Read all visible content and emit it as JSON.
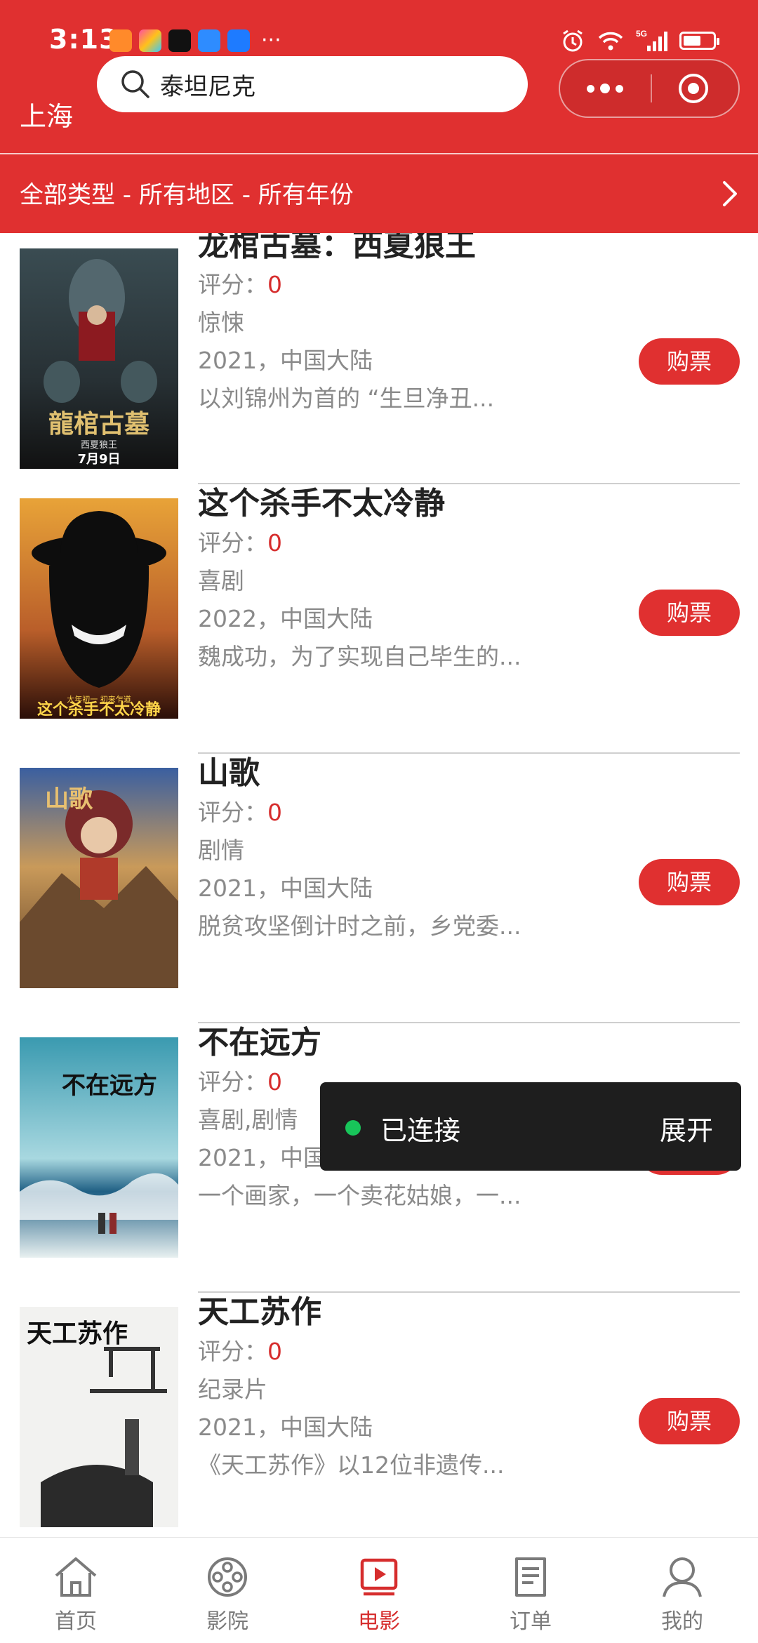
{
  "status_bar": {
    "time": "3:13",
    "more": "···",
    "network": "5G"
  },
  "header": {
    "city": "上海",
    "search_text": "泰坦尼克"
  },
  "filter": {
    "label": "全部类型 - 所有地区 - 所有年份"
  },
  "movies": [
    {
      "title": "龙棺古墓：西夏狼王",
      "score_label": "评分：",
      "score": "0",
      "genre": "惊悚",
      "year_region": "2021，中国大陆",
      "summary": "以刘锦州为首的 “生旦净丑...",
      "buy_label": "购票",
      "poster_text": "龍棺古墓",
      "poster_sub": "西夏狼王",
      "poster_date": "7月9日"
    },
    {
      "title": "这个杀手不太冷静",
      "score_label": "评分：",
      "score": "0",
      "genre": "喜剧",
      "year_region": "2022，中国大陆",
      "summary": "魏成功，为了实现自己毕生的...",
      "buy_label": "购票",
      "poster_text": "这个杀手不太冷静",
      "poster_sub": "大年初一 初来乍道"
    },
    {
      "title": "山歌",
      "score_label": "评分：",
      "score": "0",
      "genre": "剧情",
      "year_region": "2021，中国大陆",
      "summary": "脱贫攻坚倒计时之前，乡党委...",
      "buy_label": "购票",
      "poster_text": "山歌"
    },
    {
      "title": "不在远方",
      "score_label": "评分：",
      "score": "0",
      "genre": "喜剧,剧情",
      "year_region": "2021，中国大陆",
      "summary": "一个画家，一个卖花姑娘，一...",
      "buy_label": "购票",
      "poster_text": "不在远方"
    },
    {
      "title": "天工苏作",
      "score_label": "评分：",
      "score": "0",
      "genre": "纪录片",
      "year_region": "2021，中国大陆",
      "summary": "《天工苏作》以12位非遗传...",
      "buy_label": "购票",
      "poster_text": "天工苏作"
    }
  ],
  "toast": {
    "status": "已连接",
    "action": "展开"
  },
  "tabbar": {
    "items": [
      {
        "label": "首页",
        "icon": "home-icon"
      },
      {
        "label": "影院",
        "icon": "film-reel-icon"
      },
      {
        "label": "电影",
        "icon": "play-icon",
        "active": true
      },
      {
        "label": "订单",
        "icon": "order-icon"
      },
      {
        "label": "我的",
        "icon": "user-icon"
      }
    ]
  },
  "colors": {
    "brand_red": "#e03030",
    "score_red": "#d62d2d",
    "connected_green": "#18c55a"
  }
}
